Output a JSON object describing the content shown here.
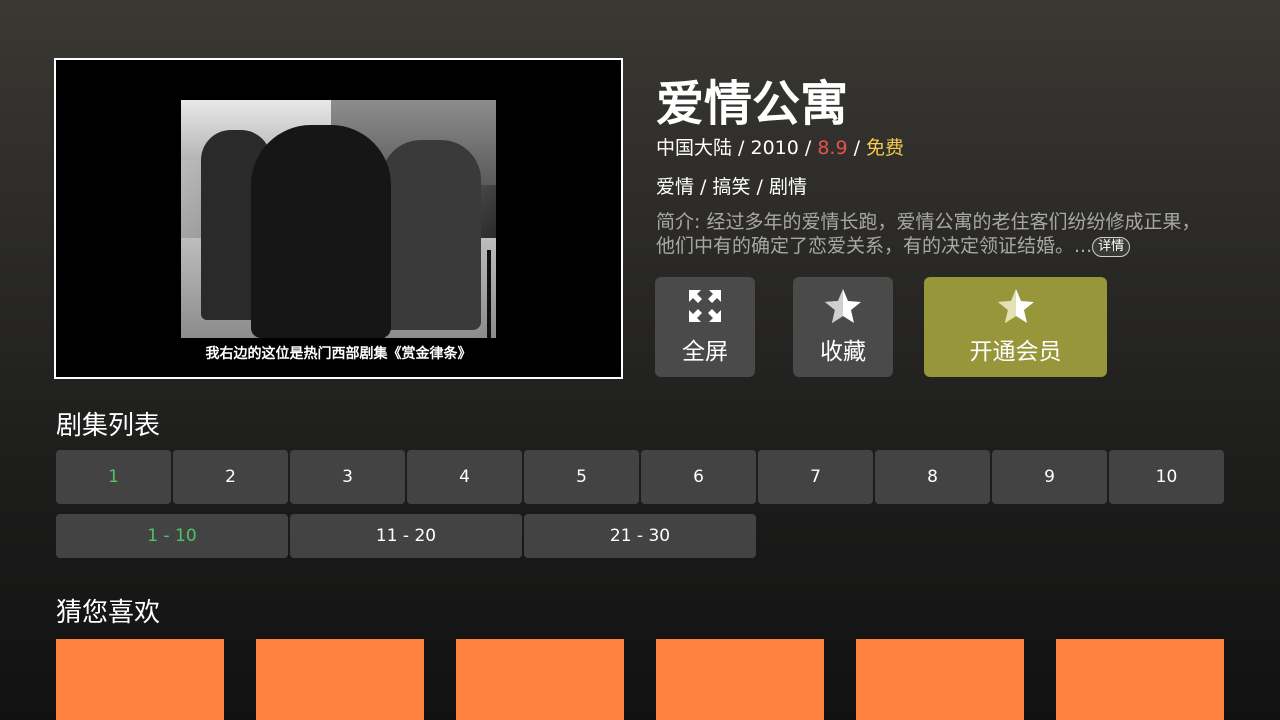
{
  "player": {
    "subtitle": "我右边的这位是热门西部剧集《赏金律条》"
  },
  "info": {
    "title": "爱情公寓",
    "region": "中国大陆",
    "year": "2010",
    "rating": "8.9",
    "price": "免费",
    "sep": " / ",
    "genres": [
      "爱情",
      "搞笑",
      "剧情"
    ],
    "intro": "简介: 经过多年的爱情长跑，爱情公寓的老住客们纷纷修成正果，他们中有的确定了恋爱关系，有的决定领证结婚。...",
    "detail_label": "详情"
  },
  "actions": {
    "fullscreen": {
      "label": "全屏",
      "icon": "fullscreen-icon"
    },
    "favorite": {
      "label": "收藏",
      "icon": "star-icon"
    },
    "vip": {
      "label": "开通会员",
      "icon": "star-icon"
    }
  },
  "episodes": {
    "title": "剧集列表",
    "items": [
      "1",
      "2",
      "3",
      "4",
      "5",
      "6",
      "7",
      "8",
      "9",
      "10"
    ],
    "ranges": [
      "1 - 10",
      "11 - 20",
      "21 - 30"
    ]
  },
  "recommend": {
    "title": "猜您喜欢"
  },
  "colors": {
    "accent_green": "#4cc46a",
    "rating_red": "#e0554a",
    "free_yellow": "#f2c94c",
    "vip_button": "#97963a",
    "rec_tile": "#ff8140"
  }
}
